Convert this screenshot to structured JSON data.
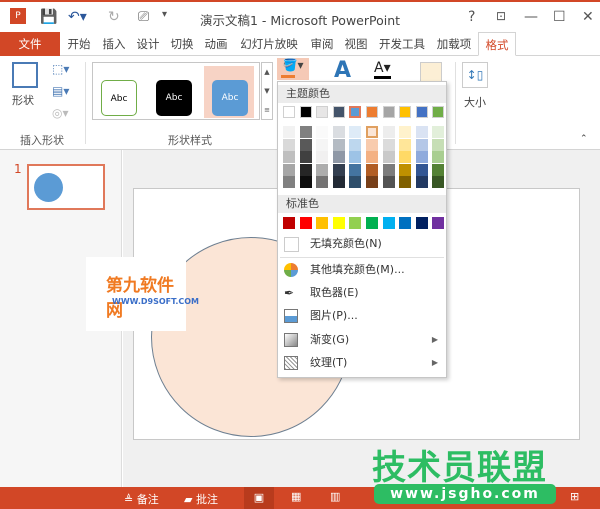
{
  "window": {
    "title": "演示文稿1 - Microsoft PowerPoint",
    "help": "?",
    "minimize": "—",
    "maximize": "☐",
    "close": "✕",
    "restore_ribbon": "⊡"
  },
  "tabs": [
    {
      "label": "文件"
    },
    {
      "label": "开始"
    },
    {
      "label": "插入"
    },
    {
      "label": "设计"
    },
    {
      "label": "切换"
    },
    {
      "label": "动画"
    },
    {
      "label": "幻灯片放映"
    },
    {
      "label": "审阅"
    },
    {
      "label": "视图"
    },
    {
      "label": "开发工具"
    },
    {
      "label": "加载项"
    },
    {
      "label": "格式",
      "active": true
    }
  ],
  "ribbon": {
    "insert_shapes": {
      "label": "插入形状",
      "shapes_button": "形状"
    },
    "shape_styles": {
      "label": "形状样式",
      "styles": [
        {
          "text": "Abc",
          "fill": "#ffffff",
          "border": "#70ad47",
          "color": "#000"
        },
        {
          "text": "Abc",
          "fill": "#000000",
          "border": "#000000",
          "color": "#fff"
        },
        {
          "text": "Abc",
          "fill": "#5b9bd5",
          "border": "#41719c",
          "color": "#fff",
          "selected": true
        }
      ]
    },
    "size": {
      "label": "大小"
    }
  },
  "slides_pane": {
    "slide_number": "1"
  },
  "fill_menu": {
    "theme_header": "主题颜色",
    "theme_colors": [
      "#ffffff",
      "#000000",
      "#e7e6e6",
      "#44546a",
      "#5b9bd5",
      "#ed7d31",
      "#a5a5a5",
      "#ffc000",
      "#4472c4",
      "#70ad47"
    ],
    "selected_theme_index": 4,
    "standard_header": "标准色",
    "standard_colors": [
      "#c00000",
      "#ff0000",
      "#ffc000",
      "#ffff00",
      "#92d050",
      "#00b050",
      "#00b0f0",
      "#0070c0",
      "#002060",
      "#7030a0"
    ],
    "items": [
      {
        "label": "无填充颜色(N)",
        "icon": "no-fill-icon"
      },
      {
        "label": "其他填充颜色(M)...",
        "icon": "color-wheel-icon"
      },
      {
        "label": "取色器(E)",
        "icon": "eyedropper-icon"
      },
      {
        "label": "图片(P)...",
        "icon": "picture-icon"
      },
      {
        "label": "渐变(G)",
        "icon": "gradient-icon",
        "submenu": true
      },
      {
        "label": "纹理(T)",
        "icon": "texture-icon",
        "submenu": true
      }
    ]
  },
  "shape": {
    "fill": "#fbe5d6",
    "outline": "#6d7f91"
  },
  "status": {
    "notes": "备注",
    "comments": "批注"
  },
  "watermarks": {
    "d9soft_cn": "第九软件网",
    "d9soft_url": "WWW.D9SOFT.COM",
    "jsgho_cn": "技术员联盟",
    "jsgho_url": "www.jsgho.com"
  },
  "accent": "#d24726"
}
